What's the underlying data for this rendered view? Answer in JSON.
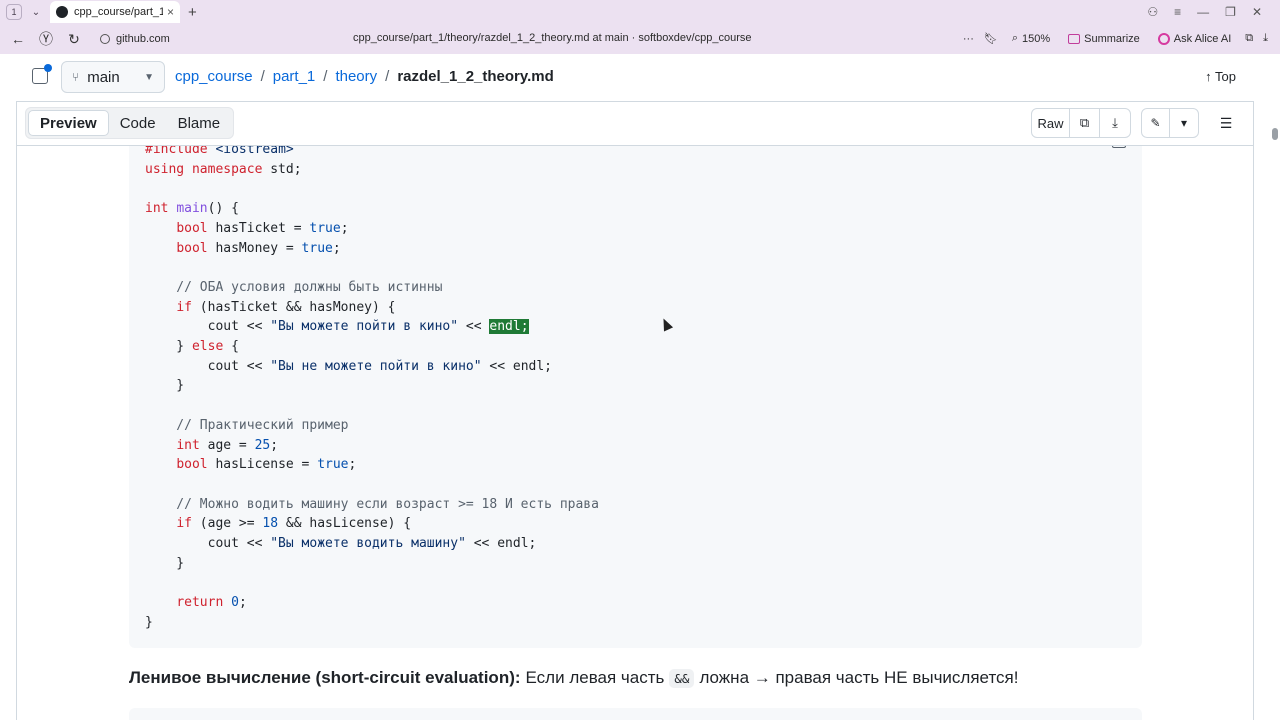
{
  "browser": {
    "tab_count": "1",
    "tab_title": "cpp_course/part_1/theo",
    "window_url_title": "cpp_course/part_1/theory/razdel_1_2_theory.md at main · softboxdev/cpp_course",
    "site": "github.com",
    "zoom": "150%",
    "summarize_label": "Summarize",
    "ask_alice_label": "Ask Alice AI"
  },
  "repo_header": {
    "branch": "main",
    "breadcrumb": [
      "cpp_course",
      "part_1",
      "theory"
    ],
    "file_name": "razdel_1_2_theory.md",
    "top_label": "Top"
  },
  "toolbar": {
    "tabs": [
      "Preview",
      "Code",
      "Blame"
    ],
    "active_tab": "Preview",
    "raw_label": "Raw"
  },
  "code_lines": [
    "#include <iostream>",
    "using namespace std;",
    "",
    "int main() {",
    "    bool hasTicket = true;",
    "    bool hasMoney = true;",
    "",
    "    // ОБА условия должны быть истинны",
    "    if (hasTicket && hasMoney) {",
    "        cout << \"Вы можете пойти в кино\" << endl;",
    "    } else {",
    "        cout << \"Вы не можете пойти в кино\" << endl;",
    "    }",
    "",
    "    // Практический пример",
    "    int age = 25;",
    "    bool hasLicense = true;",
    "",
    "    // Можно водить машину если возраст >= 18 И есть права",
    "    if (age >= 18 && hasLicense) {",
    "        cout << \"Вы можете водить машину\" << endl;",
    "    }",
    "",
    "    return 0;",
    "}"
  ],
  "paragraph": {
    "bold": "Ленивое вычисление (short-circuit evaluation):",
    "text_before_code": "Если левая часть",
    "code": "&&",
    "text_after_code": "ложна → правая часть НЕ вычисляется!"
  }
}
